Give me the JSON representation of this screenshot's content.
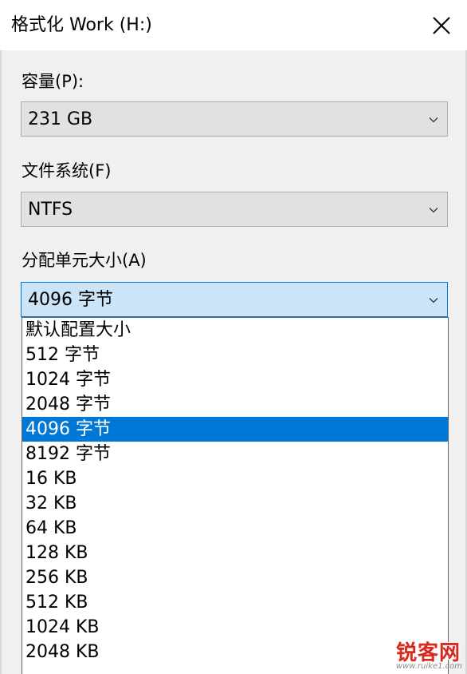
{
  "window": {
    "title": "格式化 Work (H:)"
  },
  "capacity": {
    "label": "容量(P):",
    "value": "231 GB"
  },
  "filesystem": {
    "label": "文件系统(F)",
    "value": "NTFS"
  },
  "allocation": {
    "label": "分配单元大小(A)",
    "value": "4096 字节",
    "options": [
      "默认配置大小",
      "512 字节",
      "1024 字节",
      "2048 字节",
      "4096 字节",
      "8192 字节",
      "16 KB",
      "32 KB",
      "64 KB",
      "128 KB",
      "256 KB",
      "512 KB",
      "1024 KB",
      "2048 KB"
    ],
    "selected_index": 4
  },
  "watermark": {
    "text": "锐客网",
    "url": "www.ruike1.com"
  },
  "colors": {
    "accent": "#0078d7",
    "focused_bg": "#cce4f7",
    "watermark": "#d9281d"
  },
  "icons": {
    "close": "close-icon",
    "dropdown_arrow": "chevron-down-icon"
  }
}
